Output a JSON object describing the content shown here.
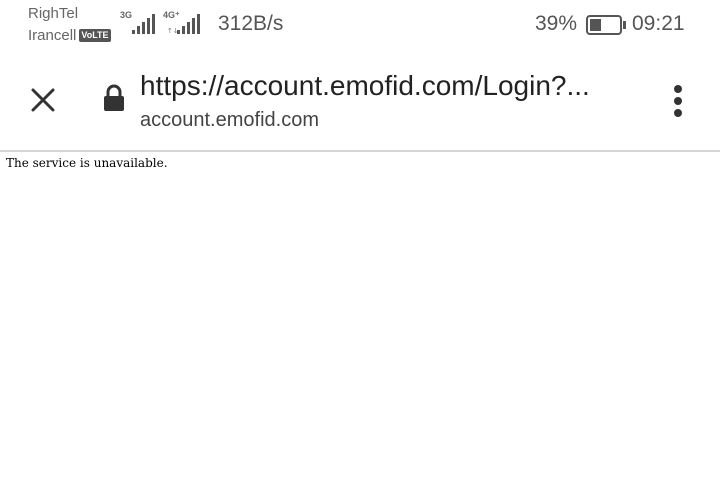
{
  "status_bar": {
    "carrier1": "RighTel",
    "carrier2": "Irancell",
    "volte_badge": "VoLTE",
    "sim1_network": "3G",
    "sim2_network": "4G⁺",
    "network_speed": "312B/s",
    "battery_percent": "39%",
    "battery_level": 0.39,
    "time": "09:21"
  },
  "toolbar": {
    "url": "https://account.emofid.com/Login?...",
    "domain": "account.emofid.com",
    "icons": [
      "close-icon",
      "lock-icon",
      "more-vert-icon"
    ]
  },
  "page": {
    "message": "The service is unavailable."
  },
  "colors": {
    "status_text": "#555555",
    "url_text": "#222222",
    "divider": "#d6d6d6"
  }
}
